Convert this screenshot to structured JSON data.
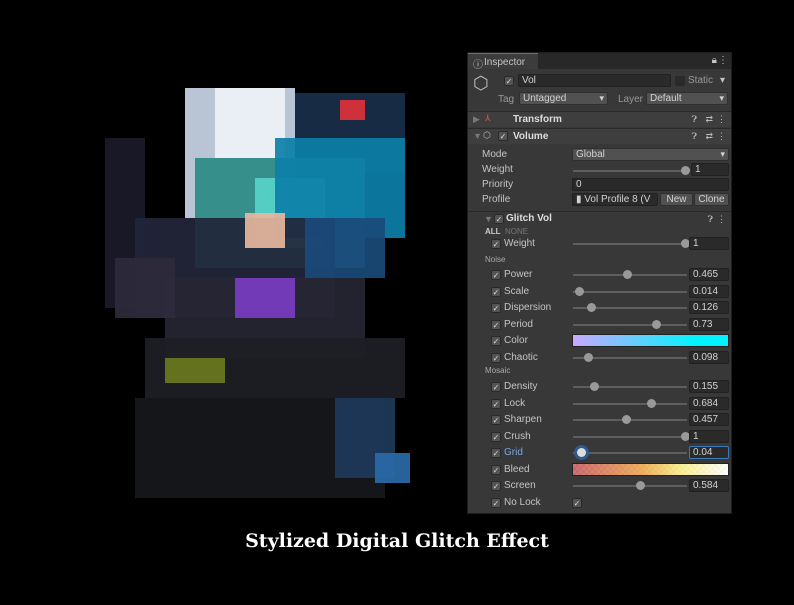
{
  "inspector": {
    "tab": "Inspector",
    "object_name": "Vol",
    "static_label": "Static",
    "tag_label": "Tag",
    "tag_value": "Untagged",
    "layer_label": "Layer",
    "layer_value": "Default",
    "transform": "Transform",
    "volume": "Volume",
    "volume_props": {
      "mode_label": "Mode",
      "mode_value": "Global",
      "weight_label": "Weight",
      "weight_value": "1",
      "weight_fraction": 1,
      "priority_label": "Priority",
      "priority_value": "0",
      "profile_label": "Profile",
      "profile_value": "Vol Profile 8 (V",
      "new": "New",
      "clone": "Clone"
    },
    "glitch": {
      "title": "Glitch Vol",
      "all": "ALL",
      "none": "NONE",
      "weight_label": "Weight",
      "weight_value": "1",
      "weight_fraction": 1
    },
    "noise_header": "Noise",
    "noise": [
      {
        "label": "Power",
        "value": "0.465",
        "fraction": 0.465
      },
      {
        "label": "Scale",
        "value": "0.014",
        "fraction": 0.014
      },
      {
        "label": "Dispersion",
        "value": "0.126",
        "fraction": 0.126
      },
      {
        "label": "Period",
        "value": "0.73",
        "fraction": 0.73
      },
      {
        "label": "Color",
        "type": "color"
      },
      {
        "label": "Chaotic",
        "value": "0.098",
        "fraction": 0.098
      }
    ],
    "mosaic_header": "Mosaic",
    "mosaic": [
      {
        "label": "Density",
        "value": "0.155",
        "fraction": 0.155
      },
      {
        "label": "Lock",
        "value": "0.684",
        "fraction": 0.684
      },
      {
        "label": "Sharpen",
        "value": "0.457",
        "fraction": 0.457
      },
      {
        "label": "Crush",
        "value": "1",
        "fraction": 1
      },
      {
        "label": "Grid",
        "value": "0.04",
        "fraction": 0.04,
        "focused": true
      },
      {
        "label": "Bleed",
        "type": "gradient"
      },
      {
        "label": "Screen",
        "value": "0.584",
        "fraction": 0.584
      },
      {
        "label": "No Lock",
        "type": "toggle"
      }
    ],
    "colors": {
      "accent": "#3a79bb",
      "color_swatch_start": "#c8a8ff",
      "color_swatch_end": "#00f4ff"
    }
  },
  "caption": "Stylized Digital Glitch Effect"
}
